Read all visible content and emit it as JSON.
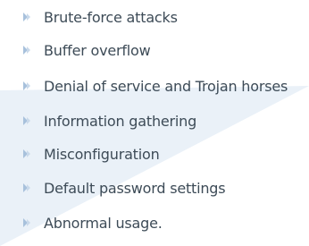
{
  "colors": {
    "text": "#3d4b57",
    "bullet": "#c9d9ea",
    "bullet_dark": "#a8c1dc",
    "wedge": "#eaf1f8"
  },
  "icon": "chevron-bullet-icon",
  "items": [
    {
      "label": "Brute-force attacks"
    },
    {
      "label": "Buffer overflow"
    },
    {
      "label": "Denial of service and Trojan horses"
    },
    {
      "label": "Information gathering"
    },
    {
      "label": "Misconfiguration"
    },
    {
      "label": "Default password settings"
    },
    {
      "label": "Abnormal usage."
    }
  ]
}
